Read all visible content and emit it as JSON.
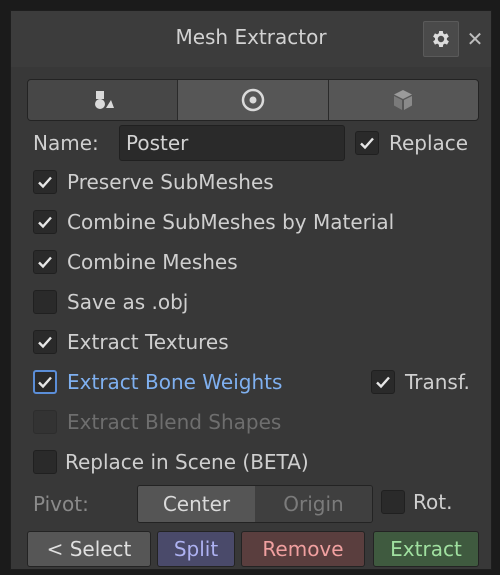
{
  "window": {
    "title": "Mesh Extractor"
  },
  "icons": {
    "settings": "gear-icon",
    "close": "close-icon"
  },
  "toolbar": {
    "tabs": [
      "shapes-icon",
      "target-icon",
      "cube-icon"
    ]
  },
  "name": {
    "label": "Name:",
    "value": "Poster"
  },
  "replace": {
    "label": "Replace",
    "checked": true
  },
  "options": {
    "preserve_submeshes": {
      "label": "Preserve SubMeshes",
      "checked": true
    },
    "combine_submeshes": {
      "label": "Combine SubMeshes by Material",
      "checked": true
    },
    "combine_meshes": {
      "label": "Combine Meshes",
      "checked": true
    },
    "save_obj": {
      "label": "Save as .obj",
      "checked": false
    },
    "extract_textures": {
      "label": "Extract Textures",
      "checked": true
    },
    "extract_bone_weights": {
      "label": "Extract Bone Weights",
      "checked": true
    },
    "transf": {
      "label": "Transf.",
      "checked": true
    },
    "extract_blend_shapes": {
      "label": "Extract Blend Shapes",
      "checked": false,
      "disabled": true
    },
    "replace_in_scene": {
      "label": "Replace in Scene (BETA)",
      "checked": false
    }
  },
  "pivot": {
    "label": "Pivot:",
    "center": "Center",
    "origin": "Origin",
    "rot_label": "Rot.",
    "rot_checked": false
  },
  "actions": {
    "select": "< Select",
    "split": "Split",
    "remove": "Remove",
    "extract": "Extract"
  },
  "colors": {
    "panel": "#383838",
    "split_bg": "#4a4a6a",
    "split_text": "#aeb2f2",
    "remove_bg": "#5a3e3e",
    "remove_text": "#f0a0a0",
    "extract_bg": "#3f5a3f",
    "extract_text": "#a0e0a0"
  }
}
